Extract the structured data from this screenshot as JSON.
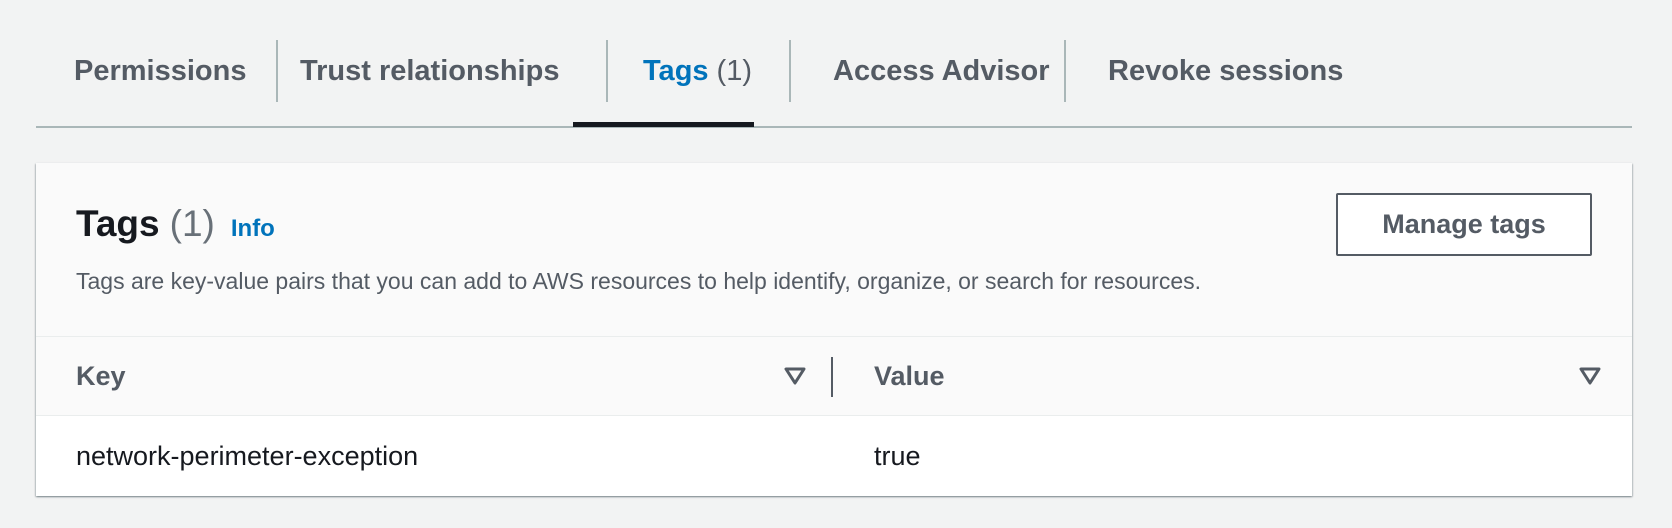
{
  "tabs": [
    {
      "label": "Permissions",
      "count": ""
    },
    {
      "label": "Trust relationships",
      "count": ""
    },
    {
      "label": "Tags",
      "count": "(1)"
    },
    {
      "label": "Access Advisor",
      "count": ""
    },
    {
      "label": "Revoke sessions",
      "count": ""
    }
  ],
  "active_tab": "Tags",
  "panel": {
    "title": "Tags",
    "count": "(1)",
    "info_link": "Info",
    "description": "Tags are key-value pairs that you can add to AWS resources to help identify, organize, or search for resources.",
    "manage_button": "Manage tags"
  },
  "table": {
    "columns": [
      "Key",
      "Value"
    ],
    "rows": [
      {
        "key": "network-perimeter-exception",
        "value": "true"
      }
    ]
  },
  "icons": {
    "sort": "sort-descending-triangle-icon"
  },
  "colors": {
    "accent": "#0073bb",
    "text": "#16191f",
    "muted": "#545b64",
    "background": "#f2f3f3"
  }
}
